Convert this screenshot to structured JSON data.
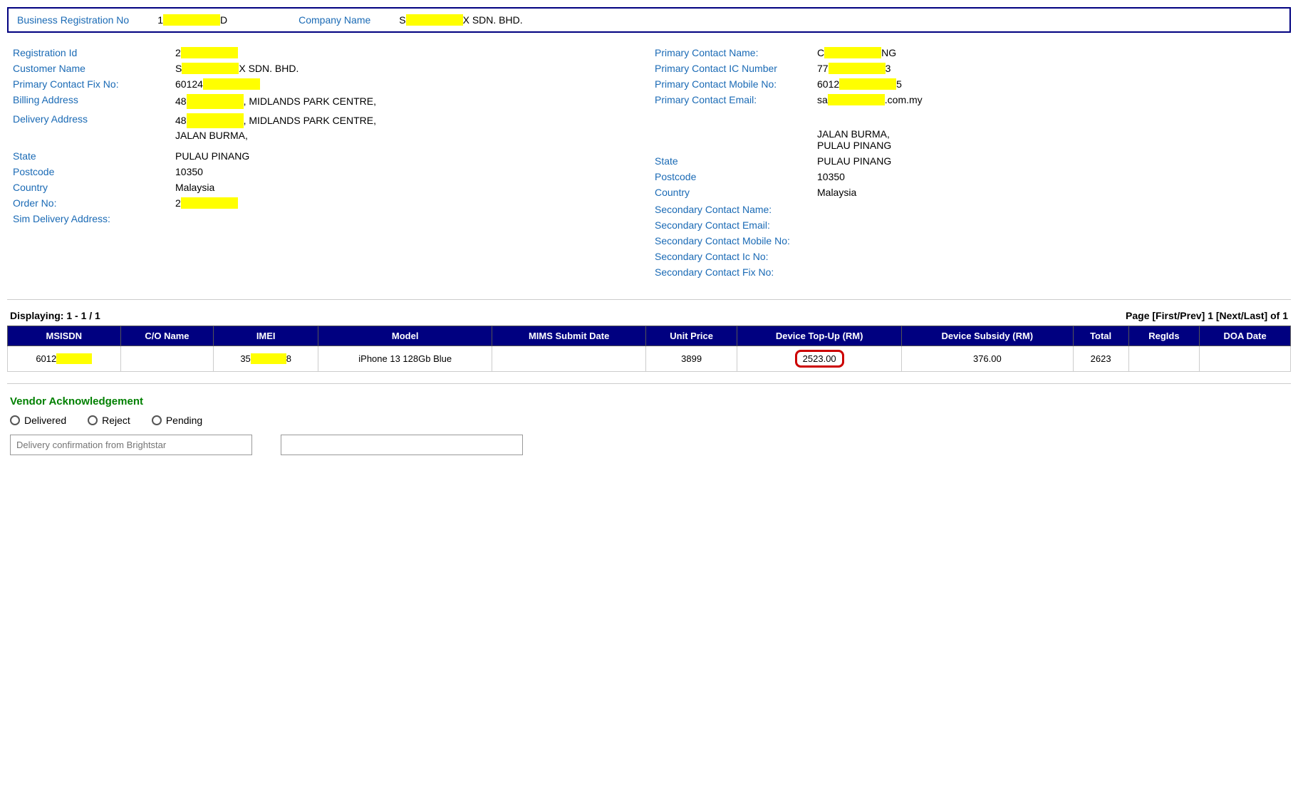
{
  "topBox": {
    "regNoLabel": "Business Registration No",
    "regNoValue1": "1",
    "regNoValue2": "D",
    "companyNameLabel": "Company Name",
    "companyNameValue1": "S",
    "companyNameValue2": "X SDN. BHD."
  },
  "leftCol": {
    "registrationIdLabel": "Registration Id",
    "registrationIdValue1": "2",
    "customerNameLabel": "Customer Name",
    "customerNameValue1": "S",
    "customerNameValue2": "X SDN. BHD.",
    "primaryContactFixLabel": "Primary Contact Fix No:",
    "primaryContactFixValue": "60124",
    "primaryContactFixValue2": "",
    "billingAddressLabel": "Billing Address",
    "billingAddressLine1a": "48",
    "billingAddressLine1b": ", MIDLANDS PARK CENTRE,",
    "deliveryAddressLabel": "Delivery Address",
    "deliveryAddressLine1a": "48",
    "deliveryAddressLine1b": ", MIDLANDS PARK CENTRE,",
    "deliveryAddressLine2": "JALAN BURMA,",
    "stateLabel": "State",
    "stateValue": "PULAU PINANG",
    "postcodeLabel": "Postcode",
    "postcodeValue": "10350",
    "countryLabel": "Country",
    "countryValue": "Malaysia",
    "orderNoLabel": "Order No:",
    "orderNoValue": "2",
    "simDeliveryLabel": "Sim Delivery Address:"
  },
  "rightCol": {
    "primaryContactNameLabel": "Primary Contact Name:",
    "primaryContactNameValue1": "C",
    "primaryContactNameValue2": "NG",
    "primaryContactICLabel": "Primary Contact IC Number",
    "primaryContactICValue1": "77",
    "primaryContactICValue2": "3",
    "primaryContactMobileLabel": "Primary Contact Mobile No:",
    "primaryContactMobileValue": "6012",
    "primaryContactMobileValue2": "5",
    "primaryContactEmailLabel": "Primary Contact Email:",
    "primaryContactEmailValue1": "sa",
    "primaryContactEmailValue2": ".com.my",
    "jalanBurma": "JALAN BURMA,",
    "pulauPinang": "PULAU PINANG",
    "stateLabel": "State",
    "stateValue": "PULAU PINANG",
    "postcodeLabel": "Postcode",
    "postcodeValue": "10350",
    "countryLabel": "Country",
    "countryValue": "Malaysia",
    "secondaryContactNameLabel": "Secondary Contact Name:",
    "secondaryContactEmailLabel": "Secondary Contact Email:",
    "secondaryContactMobileLabel": "Secondary Contact Mobile No:",
    "secondaryContactIcLabel": "Secondary Contact Ic No:",
    "secondaryContactFixLabel": "Secondary Contact Fix No:"
  },
  "pagination": {
    "displaying": "Displaying: 1 - 1 / 1",
    "page": "Page [First/Prev] 1 [Next/Last] of 1"
  },
  "table": {
    "headers": [
      "MSISDN",
      "C/O Name",
      "IMEI",
      "Model",
      "MIMS Submit Date",
      "Unit Price",
      "Device Top-Up (RM)",
      "Device Subsidy (RM)",
      "Total",
      "RegIds",
      "DOA Date"
    ],
    "rows": [
      {
        "msisdn1": "6012",
        "msisdn2": "",
        "coName": "",
        "imei1": "35",
        "imei2": "8",
        "model": "iPhone 13 128Gb Blue",
        "mimsDate": "",
        "unitPrice": "3899",
        "deviceTopUp": "2523.00",
        "deviceSubsidy": "376.00",
        "total": "2623",
        "regIds": "",
        "doaDate": ""
      }
    ]
  },
  "vendor": {
    "title": "Vendor Acknowledgement",
    "deliveredLabel": "Delivered",
    "rejectLabel": "Reject",
    "pendingLabel": "Pending",
    "deliveryInputPlaceholder": "Delivery confirmation from Brightstar"
  }
}
